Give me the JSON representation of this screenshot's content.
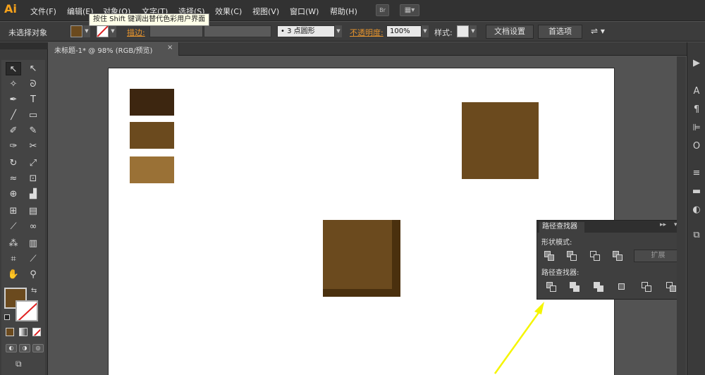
{
  "app": {
    "logo": "Ai"
  },
  "menu": [
    {
      "label": "文件(F)"
    },
    {
      "label": "编辑(E)"
    },
    {
      "label": "对象(O)"
    },
    {
      "label": "文字(T)"
    },
    {
      "label": "选择(S)"
    },
    {
      "label": "效果(C)"
    },
    {
      "label": "视图(V)"
    },
    {
      "label": "窗口(W)"
    },
    {
      "label": "帮助(H)"
    }
  ],
  "menu_extras": {
    "bridge": "Br",
    "arrange": "▦▾"
  },
  "tooltip": "按住 Shift 键调出替代色彩用户界面",
  "control": {
    "selection": "未选择对象",
    "stroke_label": "描边:",
    "brush": "3 点圆形",
    "opacity_label": "不透明度:",
    "opacity_value": "100%",
    "style_label": "样式:",
    "doc_settings": "文档设置",
    "preferences": "首选项"
  },
  "document": {
    "tab_title": "未标题-1* @ 98% (RGB/预览)",
    "close": "×"
  },
  "colors": {
    "dark_brown": "#3d2610",
    "mid_brown": "#6b4a1e",
    "light_brown": "#9a7136",
    "shadow": "#4a300e",
    "accent_orange": "#e8952d",
    "arrow_yellow": "#f5f500"
  },
  "tools": [
    {
      "icon": "selection-arrow-icon",
      "glyph": "↖"
    },
    {
      "icon": "direct-select-icon",
      "glyph": "↖"
    },
    {
      "icon": "magic-wand-icon",
      "glyph": "✧"
    },
    {
      "icon": "lasso-icon",
      "glyph": "ᘐ"
    },
    {
      "icon": "pen-icon",
      "glyph": "✒"
    },
    {
      "icon": "type-icon",
      "glyph": "T"
    },
    {
      "icon": "line-icon",
      "glyph": "╱"
    },
    {
      "icon": "rectangle-icon",
      "glyph": "▭"
    },
    {
      "icon": "brush-icon",
      "glyph": "✐"
    },
    {
      "icon": "pencil-icon",
      "glyph": "✎"
    },
    {
      "icon": "blob-brush-icon",
      "glyph": "✑"
    },
    {
      "icon": "scissors-icon",
      "glyph": "✂"
    },
    {
      "icon": "rotate-icon",
      "glyph": "↻"
    },
    {
      "icon": "scale-icon",
      "glyph": "⤢"
    },
    {
      "icon": "warp-icon",
      "glyph": "≈"
    },
    {
      "icon": "free-transform-icon",
      "glyph": "⊡"
    },
    {
      "icon": "shape-builder-icon",
      "glyph": "⊕"
    },
    {
      "icon": "graph-icon",
      "glyph": "▟"
    },
    {
      "icon": "mesh-icon",
      "glyph": "⊞"
    },
    {
      "icon": "gradient-icon",
      "glyph": "▤"
    },
    {
      "icon": "eyedropper-icon",
      "glyph": "⟋"
    },
    {
      "icon": "blend-icon",
      "glyph": "∞"
    },
    {
      "icon": "symbol-sprayer-icon",
      "glyph": "⁂"
    },
    {
      "icon": "column-graph-icon",
      "glyph": "▥"
    },
    {
      "icon": "artboard-icon",
      "glyph": "⌗"
    },
    {
      "icon": "slice-icon",
      "glyph": "⟋"
    },
    {
      "icon": "hand-icon",
      "glyph": "✋"
    },
    {
      "icon": "zoom-icon",
      "glyph": "⚲"
    }
  ],
  "pathfinder": {
    "tab": "路径查找器",
    "shape_modes_label": "形状模式:",
    "expand_button": "扩展",
    "pathfinders_label": "路径查找器:"
  },
  "dock": [
    {
      "icon": "play-icon",
      "glyph": "▶"
    },
    {
      "icon": "character-icon",
      "glyph": "A"
    },
    {
      "icon": "paragraph-icon",
      "glyph": "¶"
    },
    {
      "icon": "align-icon",
      "glyph": "⊫"
    },
    {
      "icon": "opentype-icon",
      "glyph": "O"
    },
    {
      "icon": "stroke-icon",
      "glyph": "≡"
    },
    {
      "icon": "gradient-panel-icon",
      "glyph": "▬"
    },
    {
      "icon": "transparency-icon",
      "glyph": "◐"
    },
    {
      "icon": "pathfinder-dock-icon",
      "glyph": "⧉"
    }
  ]
}
